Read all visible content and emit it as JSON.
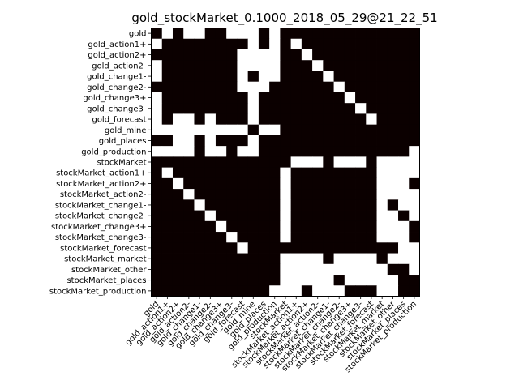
{
  "chart_data": {
    "type": "heatmap",
    "title": "gold_stockMarket_0.1000_2018_05_29@21_22_51",
    "xlabel": "",
    "ylabel": "",
    "colormap": {
      "0": "#0b0000",
      "1": "#ffffff"
    },
    "labels": [
      "gold",
      "gold_action1+",
      "gold_action2+",
      "gold_action2-",
      "gold_change1-",
      "gold_change2-",
      "gold_change3+",
      "gold_change3-",
      "gold_forecast",
      "gold_mine",
      "gold_places",
      "gold_production",
      "stockMarket",
      "stockMarket_action1+",
      "stockMarket_action2+",
      "stockMarket_action2-",
      "stockMarket_change1-",
      "stockMarket_change2-",
      "stockMarket_change3+",
      "stockMarket_change3-",
      "stockMarket_forecast",
      "stockMarket_market",
      "stockMarket_other",
      "stockMarket_places",
      "stockMarket_production"
    ],
    "matrix": [
      [
        0,
        1,
        0,
        1,
        1,
        0,
        0,
        1,
        1,
        1,
        0,
        1,
        0,
        0,
        0,
        0,
        0,
        0,
        0,
        0,
        0,
        0,
        0,
        0,
        0
      ],
      [
        1,
        0,
        0,
        0,
        0,
        0,
        0,
        0,
        0,
        1,
        0,
        1,
        0,
        1,
        0,
        0,
        0,
        0,
        0,
        0,
        0,
        0,
        0,
        0,
        0
      ],
      [
        0,
        0,
        0,
        0,
        0,
        0,
        0,
        0,
        1,
        1,
        1,
        1,
        0,
        0,
        1,
        0,
        0,
        0,
        0,
        0,
        0,
        0,
        0,
        0,
        0
      ],
      [
        1,
        0,
        0,
        0,
        0,
        0,
        0,
        0,
        1,
        1,
        1,
        1,
        0,
        0,
        0,
        1,
        0,
        0,
        0,
        0,
        0,
        0,
        0,
        0,
        0
      ],
      [
        1,
        0,
        0,
        0,
        0,
        0,
        0,
        0,
        1,
        0,
        1,
        1,
        0,
        0,
        0,
        0,
        1,
        0,
        0,
        0,
        0,
        0,
        0,
        0,
        0
      ],
      [
        0,
        0,
        0,
        0,
        0,
        0,
        0,
        0,
        1,
        1,
        1,
        0,
        0,
        0,
        0,
        0,
        0,
        1,
        0,
        0,
        0,
        0,
        0,
        0,
        0
      ],
      [
        1,
        0,
        0,
        0,
        0,
        0,
        0,
        0,
        0,
        1,
        0,
        0,
        0,
        0,
        0,
        0,
        0,
        0,
        1,
        0,
        0,
        0,
        0,
        0,
        0
      ],
      [
        1,
        0,
        0,
        0,
        0,
        0,
        0,
        0,
        0,
        1,
        0,
        0,
        0,
        0,
        0,
        0,
        0,
        0,
        0,
        1,
        0,
        0,
        0,
        0,
        0
      ],
      [
        1,
        0,
        1,
        1,
        0,
        1,
        0,
        0,
        0,
        1,
        0,
        0,
        0,
        0,
        0,
        0,
        0,
        0,
        0,
        0,
        1,
        0,
        0,
        0,
        0
      ],
      [
        1,
        1,
        1,
        1,
        1,
        1,
        1,
        1,
        1,
        0,
        1,
        1,
        0,
        0,
        0,
        0,
        0,
        0,
        0,
        0,
        0,
        0,
        0,
        0,
        0
      ],
      [
        0,
        0,
        1,
        1,
        0,
        1,
        0,
        0,
        0,
        1,
        0,
        0,
        0,
        0,
        0,
        0,
        0,
        0,
        0,
        0,
        0,
        0,
        0,
        0,
        0
      ],
      [
        1,
        1,
        1,
        1,
        0,
        1,
        1,
        0,
        1,
        1,
        0,
        0,
        0,
        0,
        0,
        0,
        0,
        0,
        0,
        0,
        0,
        0,
        0,
        0,
        1
      ],
      [
        0,
        0,
        0,
        0,
        0,
        0,
        0,
        0,
        0,
        0,
        0,
        0,
        0,
        1,
        1,
        1,
        0,
        1,
        1,
        1,
        0,
        1,
        1,
        1,
        1
      ],
      [
        0,
        1,
        0,
        0,
        0,
        0,
        0,
        0,
        0,
        0,
        0,
        0,
        1,
        0,
        0,
        0,
        0,
        0,
        0,
        0,
        0,
        1,
        1,
        1,
        1
      ],
      [
        0,
        0,
        1,
        0,
        0,
        0,
        0,
        0,
        0,
        0,
        0,
        0,
        1,
        0,
        0,
        0,
        0,
        0,
        0,
        0,
        0,
        1,
        1,
        1,
        0
      ],
      [
        0,
        0,
        0,
        1,
        0,
        0,
        0,
        0,
        0,
        0,
        0,
        0,
        1,
        0,
        0,
        0,
        0,
        0,
        0,
        0,
        0,
        1,
        1,
        1,
        1
      ],
      [
        0,
        0,
        0,
        0,
        1,
        0,
        0,
        0,
        0,
        0,
        0,
        0,
        1,
        0,
        0,
        0,
        0,
        0,
        0,
        0,
        0,
        1,
        0,
        1,
        1
      ],
      [
        0,
        0,
        0,
        0,
        0,
        1,
        0,
        0,
        0,
        0,
        0,
        0,
        1,
        0,
        0,
        0,
        0,
        0,
        0,
        0,
        0,
        1,
        1,
        0,
        1
      ],
      [
        0,
        0,
        0,
        0,
        0,
        0,
        1,
        0,
        0,
        0,
        0,
        0,
        1,
        0,
        0,
        0,
        0,
        0,
        0,
        0,
        0,
        1,
        1,
        1,
        0
      ],
      [
        0,
        0,
        0,
        0,
        0,
        0,
        0,
        1,
        0,
        0,
        0,
        0,
        1,
        0,
        0,
        0,
        0,
        0,
        0,
        0,
        0,
        1,
        1,
        1,
        0
      ],
      [
        0,
        0,
        0,
        0,
        0,
        0,
        0,
        0,
        1,
        0,
        0,
        0,
        0,
        0,
        0,
        0,
        0,
        0,
        0,
        0,
        0,
        0,
        0,
        1,
        1
      ],
      [
        0,
        0,
        0,
        0,
        0,
        0,
        0,
        0,
        0,
        0,
        0,
        0,
        1,
        1,
        1,
        1,
        0,
        1,
        1,
        1,
        1,
        0,
        1,
        1,
        1
      ],
      [
        0,
        0,
        0,
        0,
        0,
        0,
        0,
        0,
        0,
        0,
        0,
        0,
        1,
        1,
        1,
        1,
        1,
        1,
        1,
        1,
        1,
        1,
        0,
        0,
        1
      ],
      [
        0,
        0,
        0,
        0,
        0,
        0,
        0,
        0,
        0,
        0,
        0,
        0,
        1,
        1,
        1,
        1,
        1,
        0,
        1,
        1,
        1,
        1,
        1,
        0,
        0
      ],
      [
        0,
        0,
        0,
        0,
        0,
        0,
        0,
        0,
        0,
        0,
        0,
        1,
        1,
        1,
        0,
        1,
        1,
        1,
        0,
        0,
        0,
        1,
        1,
        0,
        0
      ]
    ]
  }
}
